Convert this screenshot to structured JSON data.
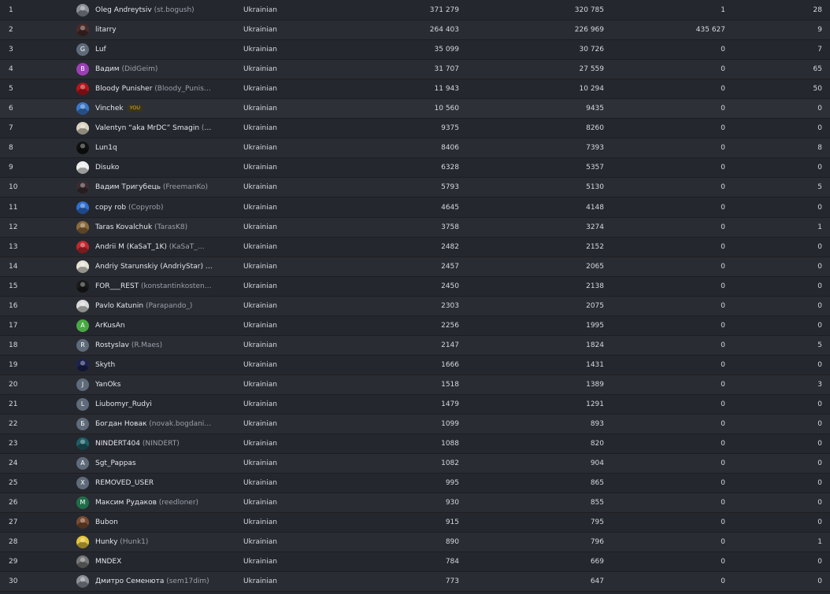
{
  "rows": [
    {
      "rank": "1",
      "name": "Oleg Andreytsiv",
      "login": "(st.bogush)",
      "lang": "Ukrainian",
      "c1": "371 279",
      "c2": "320 785",
      "c3": "1",
      "c4": "28",
      "avatar": {
        "letter": "",
        "color": "#8a8f98",
        "icon": "photo"
      }
    },
    {
      "rank": "2",
      "name": "litarry",
      "login": "",
      "lang": "Ukrainian",
      "c1": "264 403",
      "c2": "226 969",
      "c3": "435 627",
      "c4": "9",
      "avatar": {
        "letter": "",
        "color": "#4a2a2a",
        "icon": "photo"
      }
    },
    {
      "rank": "3",
      "name": "Luf",
      "login": "",
      "lang": "Ukrainian",
      "c1": "35 099",
      "c2": "30 726",
      "c3": "0",
      "c4": "7",
      "avatar": {
        "letter": "G",
        "color": "#5f6b7a",
        "icon": "letter"
      }
    },
    {
      "rank": "4",
      "name": "Вадим",
      "login": "(DidGeim)",
      "lang": "Ukrainian",
      "c1": "31 707",
      "c2": "27 559",
      "c3": "0",
      "c4": "65",
      "avatar": {
        "letter": "В",
        "color": "#9b3fb5",
        "icon": "letter"
      }
    },
    {
      "rank": "5",
      "name": "Bloody Punisher",
      "login": "(Bloody_Punis…",
      "lang": "Ukrainian",
      "c1": "11 943",
      "c2": "10 294",
      "c3": "0",
      "c4": "50",
      "avatar": {
        "letter": "",
        "color": "#b3161b",
        "icon": "photo"
      }
    },
    {
      "rank": "6",
      "name": "Vinchek",
      "login": "",
      "badge": "YOU",
      "lang": "Ukrainian",
      "c1": "10 560",
      "c2": "9435",
      "c3": "0",
      "c4": "0",
      "avatar": {
        "letter": "",
        "color": "#3a78c9",
        "icon": "photo"
      }
    },
    {
      "rank": "7",
      "name": "Valentyn “aka MrDC” Smagin",
      "login": "(a…",
      "lang": "Ukrainian",
      "c1": "9375",
      "c2": "8260",
      "c3": "0",
      "c4": "0",
      "avatar": {
        "letter": "",
        "color": "#d9d3c0",
        "icon": "photo"
      }
    },
    {
      "rank": "8",
      "name": "Lun1q",
      "login": "",
      "lang": "Ukrainian",
      "c1": "8406",
      "c2": "7393",
      "c3": "0",
      "c4": "8",
      "avatar": {
        "letter": "",
        "color": "#111111",
        "icon": "photo"
      }
    },
    {
      "rank": "9",
      "name": "Disuko",
      "login": "",
      "lang": "Ukrainian",
      "c1": "6328",
      "c2": "5357",
      "c3": "0",
      "c4": "0",
      "avatar": {
        "letter": "",
        "color": "#eeeeee",
        "icon": "photo"
      }
    },
    {
      "rank": "10",
      "name": "Вадим Тригубець",
      "login": "(FreemanKo)",
      "lang": "Ukrainian",
      "c1": "5793",
      "c2": "5130",
      "c3": "0",
      "c4": "5",
      "avatar": {
        "letter": "",
        "color": "#3a2c30",
        "icon": "photo"
      }
    },
    {
      "rank": "11",
      "name": "copy rob",
      "login": "(Copyrob)",
      "lang": "Ukrainian",
      "c1": "4645",
      "c2": "4148",
      "c3": "0",
      "c4": "0",
      "avatar": {
        "letter": "",
        "color": "#2f6fd1",
        "icon": "photo"
      }
    },
    {
      "rank": "12",
      "name": "Taras Kovalchuk",
      "login": "(TarasK8)",
      "lang": "Ukrainian",
      "c1": "3758",
      "c2": "3274",
      "c3": "0",
      "c4": "1",
      "avatar": {
        "letter": "",
        "color": "#8c6a3a",
        "icon": "photo"
      }
    },
    {
      "rank": "13",
      "name": "Andrii M (KaSaT_1K)",
      "login": "(KaSaT_…",
      "lang": "Ukrainian",
      "c1": "2482",
      "c2": "2152",
      "c3": "0",
      "c4": "0",
      "avatar": {
        "letter": "",
        "color": "#c0282d",
        "icon": "photo"
      }
    },
    {
      "rank": "14",
      "name": "Andriy Starunskiy (AndriyStar)",
      "login": "(A…",
      "lang": "Ukrainian",
      "c1": "2457",
      "c2": "2065",
      "c3": "0",
      "c4": "0",
      "avatar": {
        "letter": "",
        "color": "#e7e2d6",
        "icon": "photo"
      }
    },
    {
      "rank": "15",
      "name": "FOR___REST",
      "login": "(konstantinkosten…",
      "lang": "Ukrainian",
      "c1": "2450",
      "c2": "2138",
      "c3": "0",
      "c4": "0",
      "avatar": {
        "letter": "",
        "color": "#1a1a1a",
        "icon": "photo"
      }
    },
    {
      "rank": "16",
      "name": "Pavlo Katunin",
      "login": "(Parapando_)",
      "lang": "Ukrainian",
      "c1": "2303",
      "c2": "2075",
      "c3": "0",
      "c4": "0",
      "avatar": {
        "letter": "",
        "color": "#d9d9d9",
        "icon": "photo"
      }
    },
    {
      "rank": "17",
      "name": "ArKusAn",
      "login": "",
      "lang": "Ukrainian",
      "c1": "2256",
      "c2": "1995",
      "c3": "0",
      "c4": "0",
      "avatar": {
        "letter": "A",
        "color": "#49a843",
        "icon": "letter"
      }
    },
    {
      "rank": "18",
      "name": "Rostyslav",
      "login": "(R.Maes)",
      "lang": "Ukrainian",
      "c1": "2147",
      "c2": "1824",
      "c3": "0",
      "c4": "5",
      "avatar": {
        "letter": "R",
        "color": "#5f6b7a",
        "icon": "letter"
      }
    },
    {
      "rank": "19",
      "name": "Skyth",
      "login": "",
      "lang": "Ukrainian",
      "c1": "1666",
      "c2": "1431",
      "c3": "0",
      "c4": "0",
      "avatar": {
        "letter": "",
        "color": "#1c2250",
        "icon": "photo"
      }
    },
    {
      "rank": "20",
      "name": "YanOks",
      "login": "",
      "lang": "Ukrainian",
      "c1": "1518",
      "c2": "1389",
      "c3": "0",
      "c4": "3",
      "avatar": {
        "letter": "J",
        "color": "#5f6b7a",
        "icon": "letter"
      }
    },
    {
      "rank": "21",
      "name": "Liubomyr_Rudyi",
      "login": "",
      "lang": "Ukrainian",
      "c1": "1479",
      "c2": "1291",
      "c3": "0",
      "c4": "0",
      "avatar": {
        "letter": "L",
        "color": "#5f6b7a",
        "icon": "letter"
      }
    },
    {
      "rank": "22",
      "name": "Богдан Новак",
      "login": "(novak.bogdani…",
      "lang": "Ukrainian",
      "c1": "1099",
      "c2": "893",
      "c3": "0",
      "c4": "0",
      "avatar": {
        "letter": "Б",
        "color": "#5f6b7a",
        "icon": "letter"
      }
    },
    {
      "rank": "23",
      "name": "NINDERT404",
      "login": "(NINDERT)",
      "lang": "Ukrainian",
      "c1": "1088",
      "c2": "820",
      "c3": "0",
      "c4": "0",
      "avatar": {
        "letter": "",
        "color": "#1e5f66",
        "icon": "photo"
      }
    },
    {
      "rank": "24",
      "name": "Sgt_Pappas",
      "login": "",
      "lang": "Ukrainian",
      "c1": "1082",
      "c2": "904",
      "c3": "0",
      "c4": "0",
      "avatar": {
        "letter": "A",
        "color": "#5f6b7a",
        "icon": "letter"
      }
    },
    {
      "rank": "25",
      "name": "REMOVED_USER",
      "login": "",
      "lang": "Ukrainian",
      "c1": "995",
      "c2": "865",
      "c3": "0",
      "c4": "0",
      "avatar": {
        "letter": "X",
        "color": "#5f6b7a",
        "icon": "letter"
      }
    },
    {
      "rank": "26",
      "name": "Максим Рудаков",
      "login": "(reedloner)",
      "lang": "Ukrainian",
      "c1": "930",
      "c2": "855",
      "c3": "0",
      "c4": "0",
      "avatar": {
        "letter": "M",
        "color": "#1f6e4a",
        "icon": "letter"
      }
    },
    {
      "rank": "27",
      "name": "Bubon",
      "login": "",
      "lang": "Ukrainian",
      "c1": "915",
      "c2": "795",
      "c3": "0",
      "c4": "0",
      "avatar": {
        "letter": "",
        "color": "#7a4a30",
        "icon": "photo"
      }
    },
    {
      "rank": "28",
      "name": "Hunky",
      "login": "(Hunk1)",
      "lang": "Ukrainian",
      "c1": "890",
      "c2": "796",
      "c3": "0",
      "c4": "1",
      "avatar": {
        "letter": "",
        "color": "#e2c43a",
        "icon": "photo"
      }
    },
    {
      "rank": "29",
      "name": "MNDEX",
      "login": "",
      "lang": "Ukrainian",
      "c1": "784",
      "c2": "669",
      "c3": "0",
      "c4": "0",
      "avatar": {
        "letter": "",
        "color": "#777777",
        "icon": "photo"
      }
    },
    {
      "rank": "30",
      "name": "Дмитро Семенюта",
      "login": "(sem17dim)",
      "lang": "Ukrainian",
      "c1": "773",
      "c2": "647",
      "c3": "0",
      "c4": "0",
      "avatar": {
        "letter": "",
        "color": "#8a8f98",
        "icon": "photo"
      }
    }
  ]
}
